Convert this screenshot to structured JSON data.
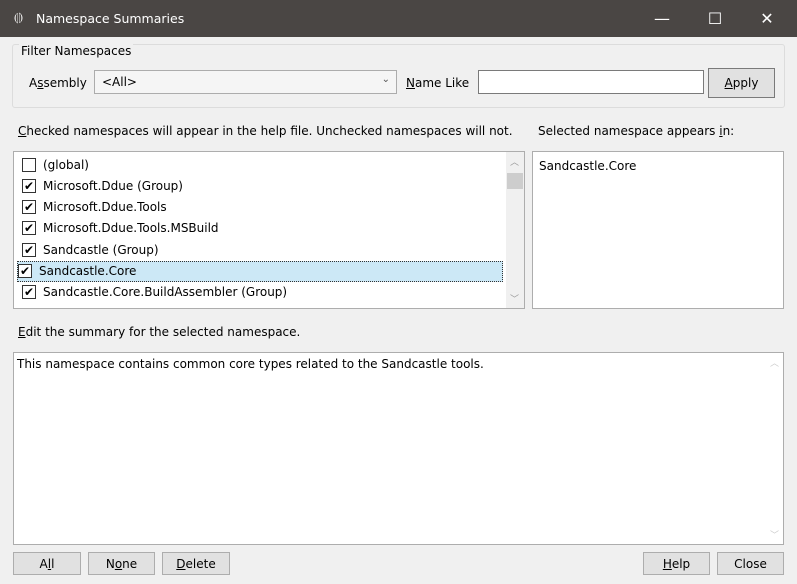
{
  "window": {
    "title": "Namespace Summaries",
    "minimize": "—",
    "maximize": "☐",
    "close": "✕"
  },
  "filter": {
    "legend": "Filter Namespaces",
    "assembly_label": "Assembly",
    "assembly_value": "<All>",
    "name_like_label": "Name Like",
    "name_like_value": "",
    "apply": "Apply"
  },
  "list_hint": "Checked namespaces will appear in the help file.  Unchecked namespaces will not.",
  "appears_label": "Selected namespace appears in:",
  "namespaces": [
    {
      "label": "(global)",
      "checked": false
    },
    {
      "label": "Microsoft.Ddue (Group)",
      "checked": true
    },
    {
      "label": "Microsoft.Ddue.Tools",
      "checked": true
    },
    {
      "label": "Microsoft.Ddue.Tools.MSBuild",
      "checked": true
    },
    {
      "label": "Sandcastle (Group)",
      "checked": true
    },
    {
      "label": "Sandcastle.Core",
      "checked": true,
      "selected": true
    },
    {
      "label": "Sandcastle.Core.BuildAssembler (Group)",
      "checked": true
    }
  ],
  "appears_in": [
    "Sandcastle.Core"
  ],
  "summary_label": "Edit the summary for the selected namespace.",
  "summary_text": "This namespace contains common core types related to the Sandcastle tools.",
  "buttons": {
    "all": "All",
    "none": "None",
    "delete": "Delete",
    "help": "Help",
    "close": "Close"
  }
}
